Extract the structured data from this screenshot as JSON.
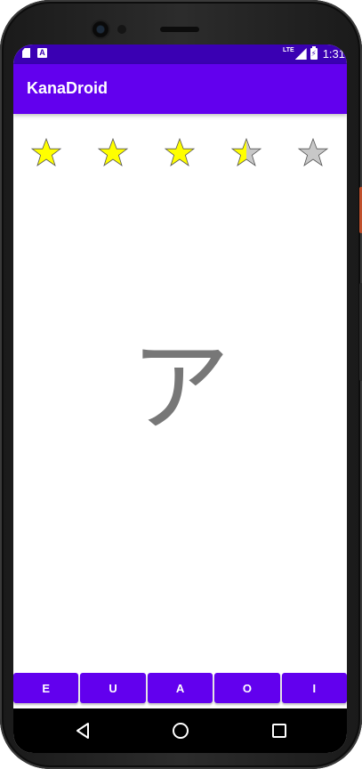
{
  "app": {
    "title": "KanaDroid"
  },
  "status_bar": {
    "time": "1:31",
    "network": "LTE"
  },
  "colors": {
    "primary": "#6200ee",
    "status_bar": "#3a00b3",
    "star_filled": "#ffff00",
    "star_empty": "#c8c8c8",
    "kana": "#777777"
  },
  "rating": {
    "stars": 5,
    "value": 3.5
  },
  "card": {
    "kana": "ア"
  },
  "answers": [
    {
      "label": "E"
    },
    {
      "label": "U"
    },
    {
      "label": "A"
    },
    {
      "label": "O"
    },
    {
      "label": "I"
    }
  ],
  "nav": {
    "back_icon": "back-triangle-icon",
    "home_icon": "home-circle-icon",
    "recents_icon": "recents-square-icon"
  }
}
